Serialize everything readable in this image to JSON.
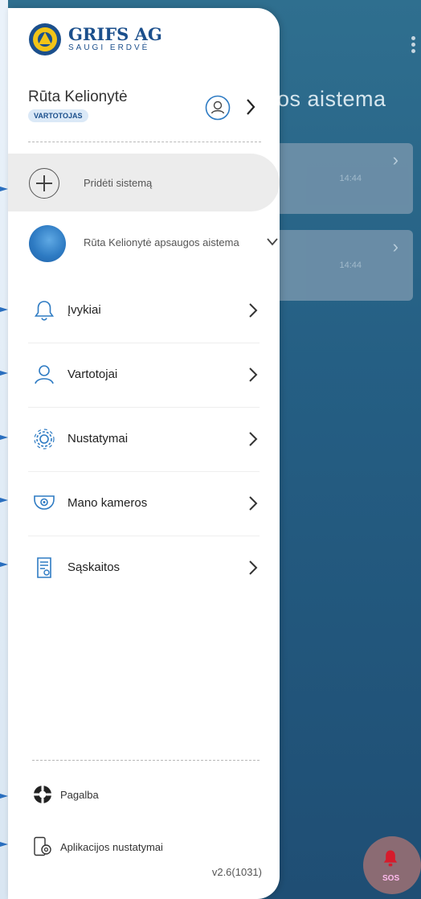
{
  "background": {
    "title_fragment": "os aistema",
    "cards": [
      {
        "time": "14:44"
      },
      {
        "time": "14:44"
      }
    ],
    "sos_label": "SOS"
  },
  "logo": {
    "name": "GRIFS AG",
    "tagline": "SAUGI ERDVĖ"
  },
  "user": {
    "name": "Rūta Kelionytė",
    "role": "VARTOTOJAS"
  },
  "add_system": {
    "label": "Pridėti sistemą"
  },
  "system": {
    "name": "Rūta Kelionytė apsaugos aistema"
  },
  "menu": [
    {
      "label": "Įvykiai",
      "icon": "bell-icon"
    },
    {
      "label": "Vartotojai",
      "icon": "user-icon"
    },
    {
      "label": "Nustatymai",
      "icon": "gear-icon"
    },
    {
      "label": "Mano kameros",
      "icon": "camera-icon"
    },
    {
      "label": "Sąskaitos",
      "icon": "invoice-icon"
    }
  ],
  "footer": {
    "help_label": "Pagalba",
    "app_settings_label": "Aplikacijos nustatymai",
    "version": "v2.6(1031)"
  },
  "colors": {
    "brand": "#1b4f8c",
    "accent": "#2e7bc3",
    "badge_bg": "#dbe9f7"
  }
}
